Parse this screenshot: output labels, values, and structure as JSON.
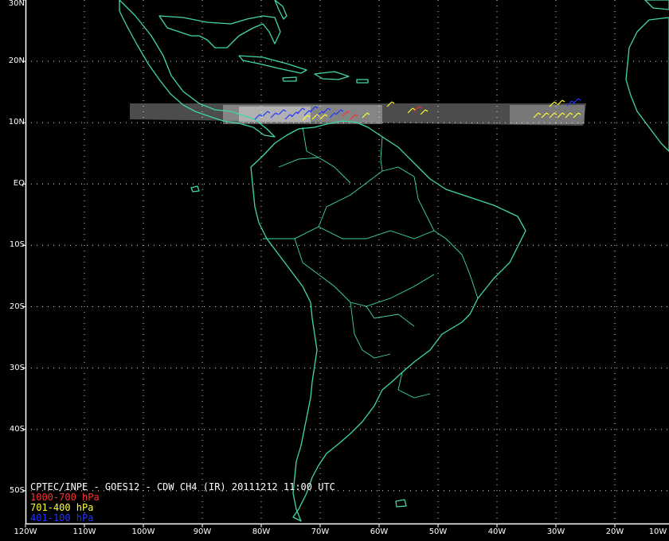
{
  "title": "CPTEC/INPE - GOES12 - CDW CH4 (IR) 20111212 11:00 UTC",
  "legend": [
    {
      "label": "1000-700 hPa",
      "color": "#ff3030"
    },
    {
      "label": "701-400 hPa",
      "color": "#ffff33"
    },
    {
      "label": "401-100 hPa",
      "color": "#2233ff"
    }
  ],
  "lat_labels": [
    "30N",
    "20N",
    "10N",
    "EQ",
    "10S",
    "20S",
    "30S",
    "40S",
    "50S"
  ],
  "lon_labels": [
    "120W",
    "110W",
    "100W",
    "90W",
    "80W",
    "70W",
    "60W",
    "50W",
    "40W",
    "30W",
    "20W",
    "10W"
  ],
  "colors": {
    "background": "#000000",
    "coastline": "#3fd9a0",
    "gridline": "#ffffff",
    "frame": "#ffffff",
    "satellite_strip": "#8a8a8a"
  }
}
